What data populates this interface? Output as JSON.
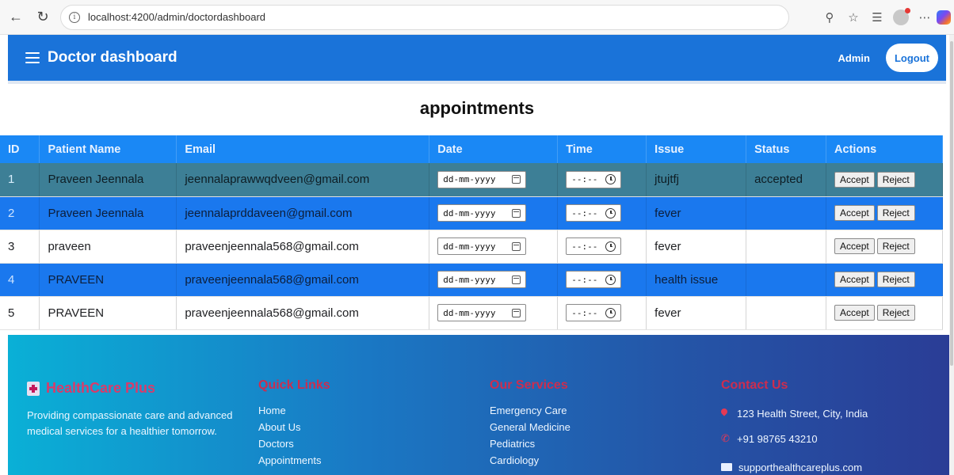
{
  "browser": {
    "url": "localhost:4200/admin/doctordashboard"
  },
  "header": {
    "title": "Doctor dashboard",
    "user_label": "Admin",
    "logout_label": "Logout"
  },
  "section": {
    "heading": "appointments"
  },
  "table": {
    "columns": [
      "ID",
      "Patient Name",
      "Email",
      "Date",
      "Time",
      "Issue",
      "Status",
      "Actions"
    ],
    "date_placeholder": "dd-mm-yyyy",
    "time_placeholder": "--:--",
    "accept_label": "Accept",
    "reject_label": "Reject",
    "rows": [
      {
        "id": "1",
        "name": "Praveen Jeennala",
        "email": "jeennalaprawwqdveen@gmail.com",
        "issue": "jtujtfj",
        "status": "accepted"
      },
      {
        "id": "2",
        "name": "Praveen Jeennala",
        "email": "jeennalaprddaveen@gmail.com",
        "issue": "fever",
        "status": ""
      },
      {
        "id": "3",
        "name": "praveen",
        "email": "praveenjeennala568@gmail.com",
        "issue": "fever",
        "status": ""
      },
      {
        "id": "4",
        "name": "PRAVEEN",
        "email": "praveenjeennala568@gmail.com",
        "issue": "health issue",
        "status": ""
      },
      {
        "id": "5",
        "name": "PRAVEEN",
        "email": "praveenjeennala568@gmail.com",
        "issue": "fever",
        "status": ""
      }
    ]
  },
  "footer": {
    "brand": "HealthCare Plus",
    "tagline": "Providing compassionate care and advanced medical services for a healthier tomorrow.",
    "quick_links": {
      "heading": "Quick Links",
      "items": [
        "Home",
        "About Us",
        "Doctors",
        "Appointments"
      ]
    },
    "services": {
      "heading": "Our Services",
      "items": [
        "Emergency Care",
        "General Medicine",
        "Pediatrics",
        "Cardiology"
      ]
    },
    "contact": {
      "heading": "Contact Us",
      "address": "123 Health Street, City, India",
      "phone": "+91 98765 43210",
      "email": "supporthealthcareplus.com"
    }
  },
  "colors": {
    "header_blue": "#1a73d9",
    "table_header": "#1a88f5",
    "row_teal": "#3d7f96",
    "row_blue": "#1a78ee",
    "footer_accent": "#cc2d4f"
  }
}
